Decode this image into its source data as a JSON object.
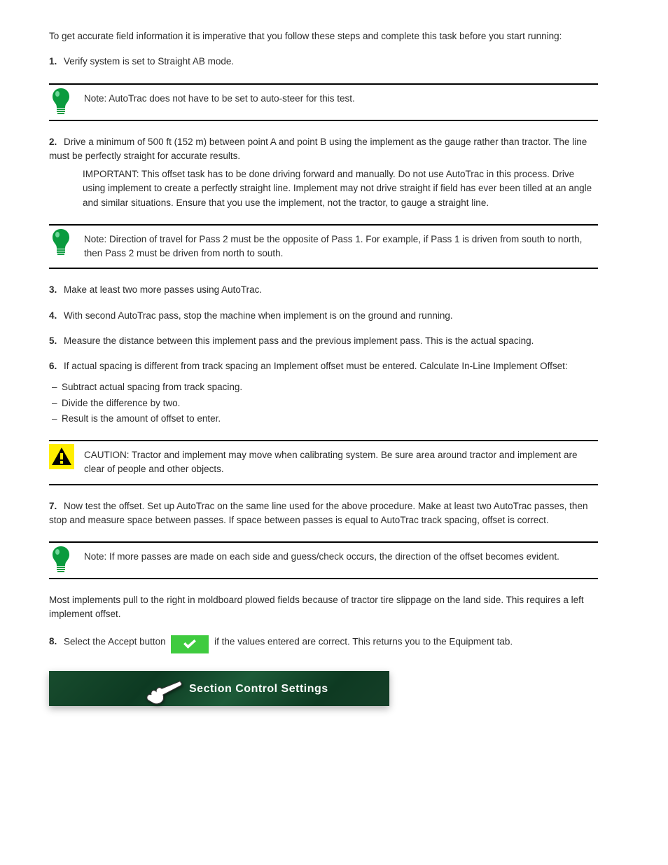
{
  "intro_p": "To get accurate field information it is imperative that you follow these steps and complete this task before you start running:",
  "step1_num": "1.",
  "step1_text": "Verify system is set to Straight AB mode.",
  "tip1_line": "Note: AutoTrac does not have to be set to auto-steer for this test.",
  "step2_num": "2.",
  "step2_text": "Drive a minimum of 500 ft (152 m) between point A and point B using the implement as the gauge rather than tractor. The line must be perfectly straight for accurate results.",
  "warn_p": "IMPORTANT: This offset task has to be done driving forward and manually. Do not use AutoTrac in this process. Drive using implement to create a perfectly straight line. Implement may not drive straight if field has ever been tilled at an angle and similar situations. Ensure that you use the implement, not the tractor, to gauge a straight line.",
  "tip2_line": "Note: Direction of travel for Pass 2 must be the opposite of Pass 1. For example, if Pass 1 is driven from south to north, then Pass 2 must be driven from north to south.",
  "step3_num": "3.",
  "step3_text": "Make at least two more passes using AutoTrac.",
  "step4_num": "4.",
  "step4_text": "With second AutoTrac pass, stop the machine when implement is on the ground and running.",
  "step5_num": "5.",
  "step5_text": "Measure the distance between this implement pass and the previous implement pass. This is the actual spacing.",
  "step6_num": "6.",
  "step6_text": "If actual spacing is different from track spacing an Implement offset must be entered. Calculate In-Line Implement Offset:",
  "offset_list": [
    "Subtract actual spacing from track spacing.",
    "Divide the difference by two.",
    "Result is the amount of offset to enter."
  ],
  "warn2_p": "CAUTION: Tractor and implement may move when calibrating system. Be sure area around tractor and implement are clear of people and other objects.",
  "step7_num": "7.",
  "step7_text": "Now test the offset. Set up AutoTrac on the same line used for the above procedure. Make at least two AutoTrac passes, then stop and measure space between passes. If space between passes is equal to AutoTrac track spacing, offset is correct.",
  "tip3_line": "Note: If more passes are made on each side and guess/check occurs, the direction of the offset becomes evident.",
  "after_tip_p": "Most implements pull to the right in moldboard plowed fields because of tractor tire slippage on the land side. This requires a left implement offset.",
  "step8_num": "8.",
  "step8_prefix": "Select the Accept button",
  "step8_suffix": "if the values entered are correct. This returns you to the Equipment tab.",
  "cta_text": "Section Control Settings"
}
